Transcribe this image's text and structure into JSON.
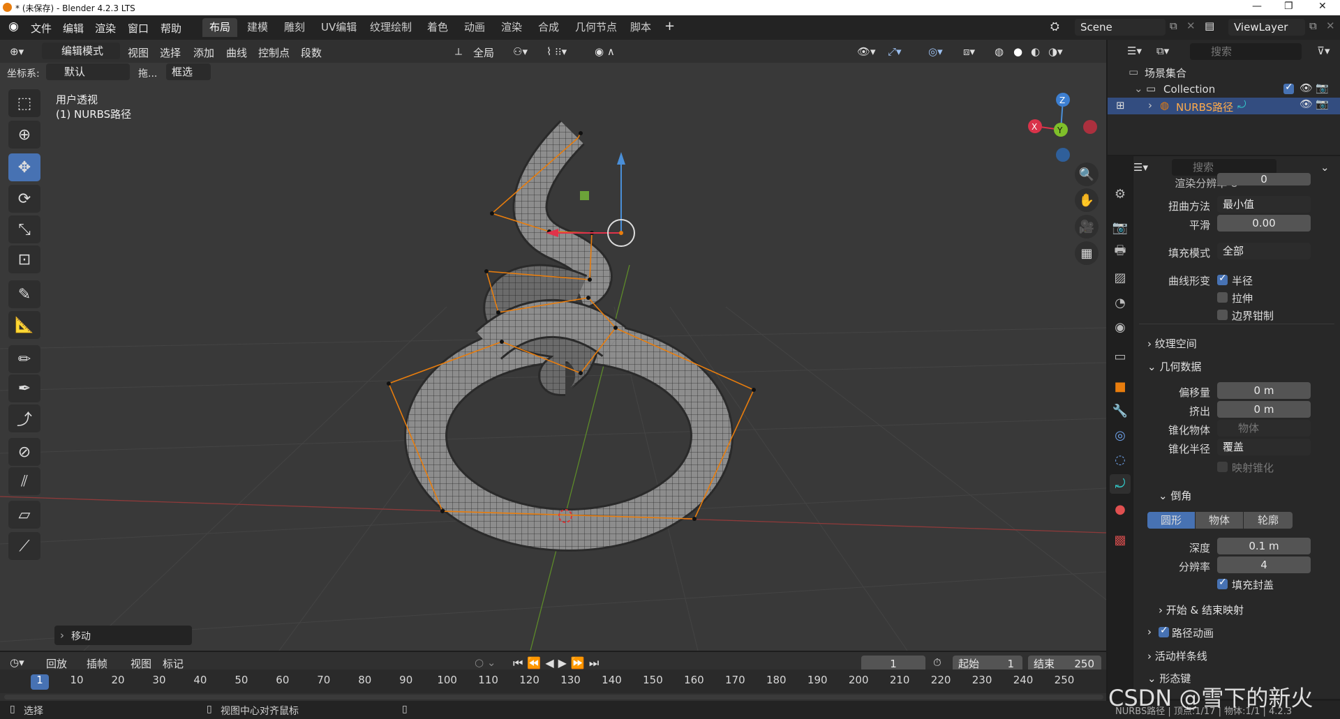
{
  "window": {
    "title": "* (未保存) - Blender 4.2.3 LTS"
  },
  "menu": [
    "文件",
    "编辑",
    "渲染",
    "窗口",
    "帮助"
  ],
  "workspaces": [
    "布局",
    "建模",
    "雕刻",
    "UV编辑",
    "纹理绘制",
    "着色",
    "动画",
    "渲染",
    "合成",
    "几何节点",
    "脚本"
  ],
  "scene": {
    "name": "Scene",
    "view_layer": "ViewLayer"
  },
  "viewport_header": {
    "mode": "编辑模式",
    "menus": [
      "视图",
      "选择",
      "添加",
      "曲线",
      "控制点",
      "段数"
    ],
    "transform_orientation": "全局",
    "coord_label": "坐标系:",
    "coord_value": "默认",
    "drag_label": "拖...",
    "select_mode": "框选"
  },
  "viewport": {
    "view_name": "用户透视",
    "object_label": "(1) NURBS路径",
    "last_op": "移动"
  },
  "outliner": {
    "search_placeholder": "搜索",
    "scene_collection": "场景集合",
    "collection": "Collection",
    "object": "NURBS路径"
  },
  "properties": {
    "search_placeholder": "搜索",
    "render_resolution_label": "渲染分辨率 U",
    "render_resolution_value": "0",
    "twist_method_label": "扭曲方法",
    "twist_method_value": "最小值",
    "smooth_label": "平滑",
    "smooth_value": "0.00",
    "fill_mode_label": "填充模式",
    "fill_mode_value": "全部",
    "curve_deform_label": "曲线形变",
    "radius_label": "半径",
    "stretch_label": "拉伸",
    "bounds_clamp_label": "边界钳制",
    "texture_space": "纹理空间",
    "geometry_data": "几何数据",
    "offset_label": "偏移量",
    "offset_value": "0 m",
    "extrude_label": "挤出",
    "extrude_value": "0 m",
    "taper_object_label": "锥化物体",
    "taper_object_placeholder": "物体",
    "taper_radius_label": "锥化半径",
    "taper_radius_value": "覆盖",
    "map_taper_label": "映射锥化",
    "bevel": "倒角",
    "bevel_tabs": [
      "圆形",
      "物体",
      "轮廓"
    ],
    "depth_label": "深度",
    "depth_value": "0.1 m",
    "resolution_label": "分辨率",
    "resolution_value": "4",
    "fill_caps_label": "填充封盖",
    "start_end_mapping": "开始 & 结束映射",
    "path_animation": "路径动画",
    "active_spline": "活动样条线",
    "shape_keys": "形态键"
  },
  "timeline": {
    "menus": [
      "回放",
      "插帧",
      "视图",
      "标记"
    ],
    "current_frame": "1",
    "start_label": "起始",
    "start_value": "1",
    "end_label": "结束",
    "end_value": "250",
    "ticks": [
      "1",
      "10",
      "20",
      "30",
      "40",
      "50",
      "60",
      "70",
      "80",
      "90",
      "100",
      "110",
      "120",
      "130",
      "140",
      "150",
      "160",
      "170",
      "180",
      "190",
      "200",
      "210",
      "220",
      "230",
      "240",
      "250"
    ]
  },
  "statusbar": {
    "select": "选择",
    "center_view": "视图中心对齐鼠标",
    "stats": "NURBS路径 | 顶点:1/17 | 物体:1/1 | 4.2.3"
  },
  "watermark": "CSDN @雪下的新火",
  "colors": {
    "accent": "#4772b3",
    "curve": "#e87d0d",
    "viewport_bg": "#393939"
  }
}
